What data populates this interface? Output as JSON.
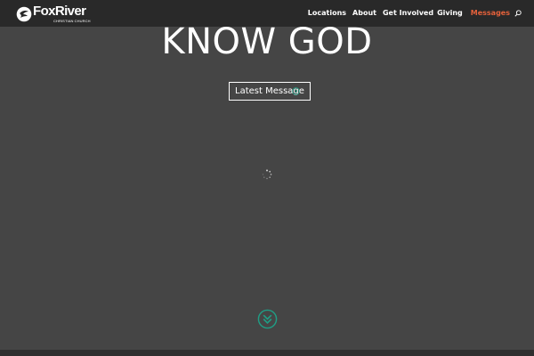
{
  "header": {
    "logo_text": "FoxRiver",
    "logo_subtext": "CHRISTIAN CHURCH",
    "nav": [
      {
        "label": "Locations",
        "active": false
      },
      {
        "label": "About",
        "active": false
      },
      {
        "label": "Get Involved",
        "active": false
      },
      {
        "label": "Giving",
        "active": false
      },
      {
        "label": "Messages",
        "active": true
      }
    ],
    "search_icon": "search-icon"
  },
  "hero": {
    "title": "KNOW GOD",
    "button_label": "Latest Message",
    "button_icon": "arrow-circle-icon"
  },
  "colors": {
    "background": "#454545",
    "header_background": "#292929",
    "active_nav": "#e4613b",
    "accent_teal": "#1f9e85",
    "text": "#ffffff"
  },
  "icons": {
    "loader": "spinner-icon",
    "scroll": "double-chevron-down-icon"
  }
}
